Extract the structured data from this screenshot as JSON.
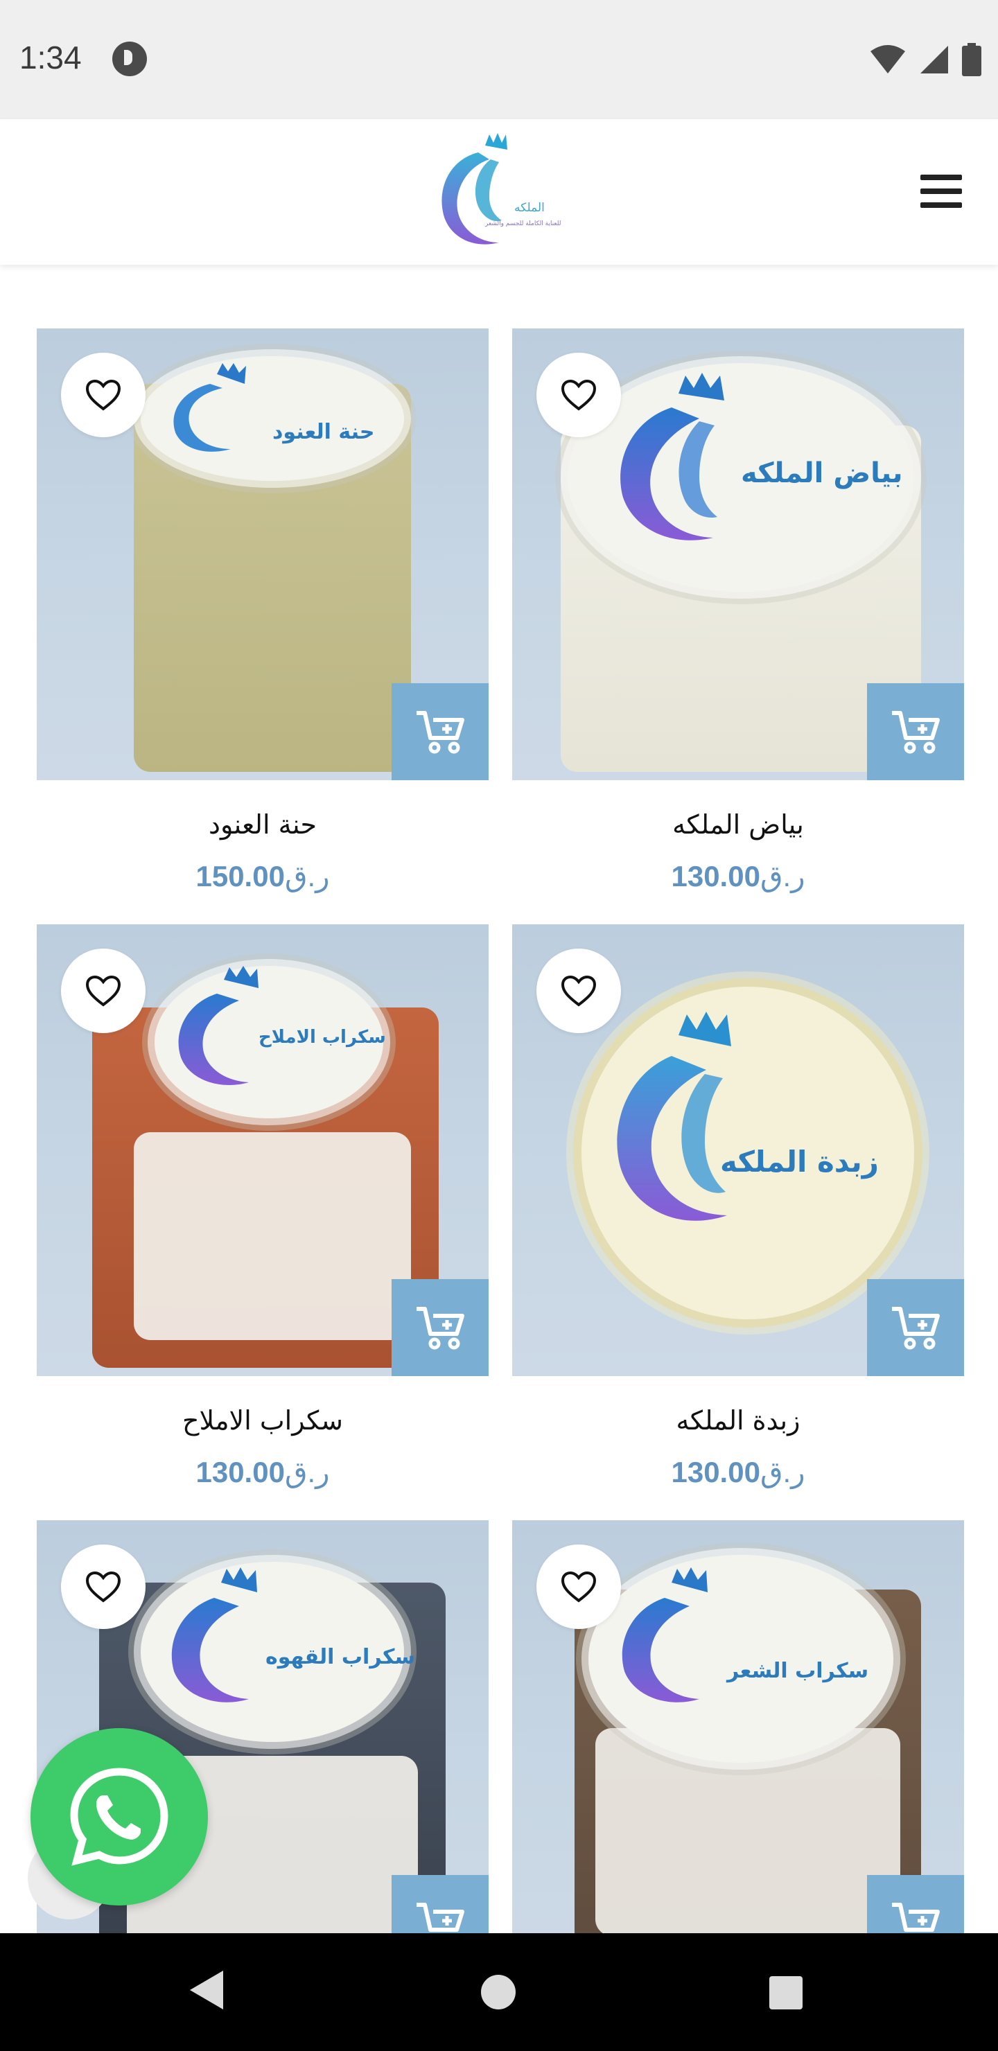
{
  "status_bar": {
    "time": "1:34",
    "icons": [
      "app-notification-icon",
      "wifi-icon",
      "cellular-signal-icon",
      "battery-icon"
    ]
  },
  "header": {
    "logo_brand": "الملكه",
    "logo_tagline": "للعناية الكاملة للجسم والشعر",
    "menu_icon": "hamburger-menu-icon"
  },
  "colors": {
    "accent": "#7aaed3",
    "price": "#5f92c0",
    "whatsapp": "#3ecb6a"
  },
  "products": [
    {
      "title": "حنة العنود",
      "price": "150.00",
      "currency": "ر.ق",
      "label": "حنة العنود"
    },
    {
      "title": "بياض الملكه",
      "price": "130.00",
      "currency": "ر.ق",
      "label": "بياض الملكه"
    },
    {
      "title": "سكراب الاملاح",
      "price": "130.00",
      "currency": "ر.ق",
      "label": "سكراب الاملاح"
    },
    {
      "title": "زبدة الملكه",
      "price": "130.00",
      "currency": "ر.ق",
      "label": "زبدة الملكه"
    },
    {
      "title": "",
      "price": "",
      "currency": "",
      "label": "سكراب القهوه"
    },
    {
      "title": "",
      "price": "",
      "currency": "",
      "label": "سكراب الشعر"
    }
  ],
  "floating": {
    "icon": "whatsapp-icon"
  }
}
